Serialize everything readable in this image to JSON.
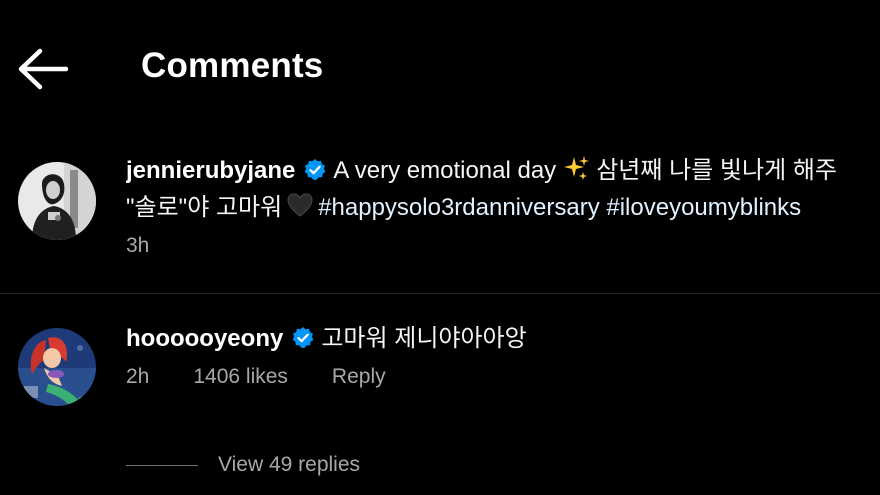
{
  "header": {
    "title": "Comments",
    "back_icon": "arrow-left-icon"
  },
  "comments": [
    {
      "username": "jennierubyjane",
      "verified": true,
      "text_line1": "A very emotional day",
      "text_line1_emoji": "sparkles-icon",
      "text_line1_korean": "삼년째 나를 빛나게 해주",
      "text_line2_quote": "\"솔로\"야 고마워",
      "text_line2_emoji": "black-heart-icon",
      "hashtags": [
        "#happysolo3rdanniversary",
        "#iloveyoumyblinks"
      ],
      "time": "3h"
    },
    {
      "username": "hoooooyeony",
      "verified": true,
      "text": "고마워 제니야아아앙",
      "time": "2h",
      "likes": "1406 likes",
      "reply_label": "Reply",
      "view_replies": "View 49 replies"
    }
  ],
  "colors": {
    "background": "#000000",
    "text": "#f5f5f5",
    "secondary_text": "#a8a8a8",
    "hashtag": "#e0f1ff",
    "verified_badge": "#0095f6"
  }
}
